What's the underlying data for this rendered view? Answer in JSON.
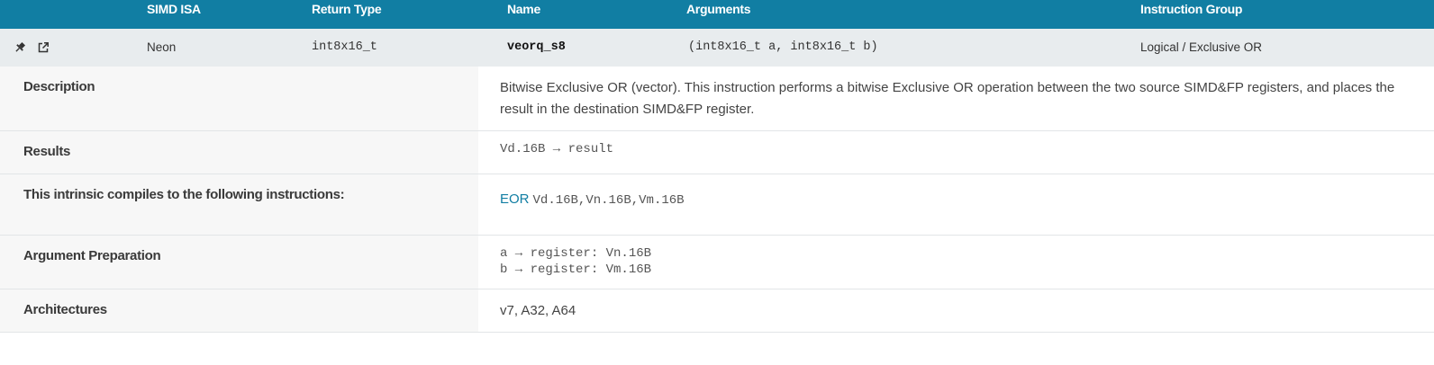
{
  "header": {
    "columns": [
      "SIMD ISA",
      "Return Type",
      "Name",
      "Arguments",
      "Instruction Group"
    ]
  },
  "summary": {
    "pin_icon": "pin-icon",
    "open_icon": "external-link-icon",
    "simd_isa": "Neon",
    "return_type": "int8x16_t",
    "name": "veorq_s8",
    "arguments": "(int8x16_t a, int8x16_t b)",
    "instruction_group": "Logical / Exclusive OR"
  },
  "details": {
    "description": {
      "label": "Description",
      "text": "Bitwise Exclusive OR (vector). This instruction performs a bitwise Exclusive OR operation between the two source SIMD&FP registers, and places the result in the destination SIMD&FP register."
    },
    "results": {
      "label": "Results",
      "text": "Vd.16B → result"
    },
    "instructions": {
      "label": "This intrinsic compiles to the following instructions:",
      "mnemonic": "EOR",
      "operands": "Vd.16B,Vn.16B,Vm.16B"
    },
    "argument_preparation": {
      "label": "Argument Preparation",
      "lines": [
        "a → register: Vn.16B",
        "b → register: Vm.16B"
      ]
    },
    "architectures": {
      "label": "Architectures",
      "text": "v7, A32, A64"
    }
  },
  "colors": {
    "header_bg": "#117ea3",
    "summary_bg": "#e8ecee",
    "label_bg": "#f7f7f7",
    "link": "#117ea3"
  }
}
